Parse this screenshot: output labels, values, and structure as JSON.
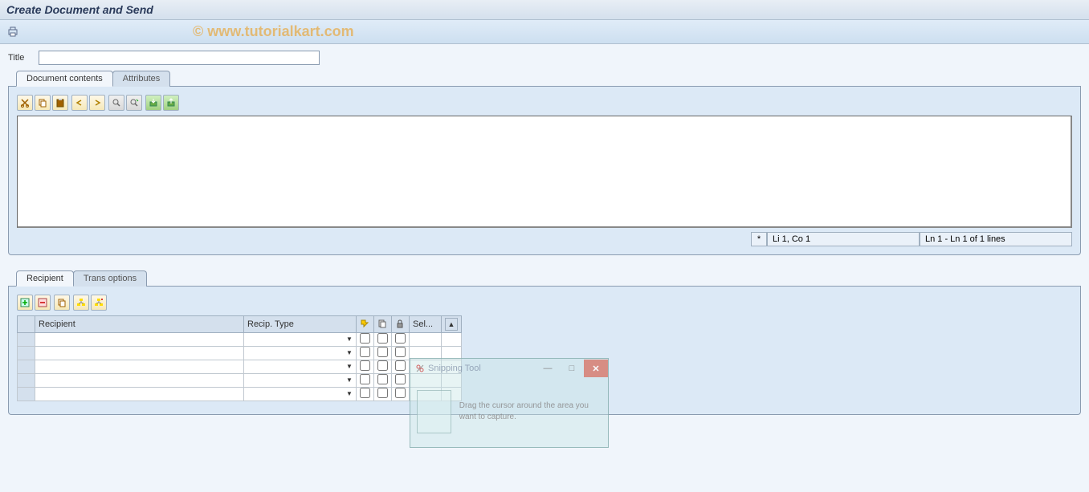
{
  "titlebar": {
    "text": "Create Document and Send"
  },
  "watermark": "© www.tutorialkart.com",
  "form": {
    "title_label": "Title",
    "title_value": ""
  },
  "upper_tabs": [
    {
      "label": "Document contents",
      "active": true
    },
    {
      "label": "Attributes",
      "active": false
    }
  ],
  "editor": {
    "content": "",
    "status_star": "*",
    "status_pos": "Li 1, Co 1",
    "status_lines": "Ln 1 - Ln 1 of 1 lines"
  },
  "lower_tabs": [
    {
      "label": "Recipient",
      "active": true
    },
    {
      "label": "Trans options",
      "active": false
    }
  ],
  "recip_table": {
    "headers": {
      "recipient": "Recipient",
      "recip_type": "Recip. Type",
      "sel": "Sel..."
    },
    "rows": [
      {
        "recipient": "",
        "type": "",
        "c1": false,
        "c2": false,
        "c3": false
      },
      {
        "recipient": "",
        "type": "",
        "c1": false,
        "c2": false,
        "c3": false
      },
      {
        "recipient": "",
        "type": "",
        "c1": false,
        "c2": false,
        "c3": false
      },
      {
        "recipient": "",
        "type": "",
        "c1": false,
        "c2": false,
        "c3": false
      },
      {
        "recipient": "",
        "type": "",
        "c1": false,
        "c2": false,
        "c3": false
      }
    ]
  },
  "snipping": {
    "title": "Snipping Tool",
    "hint": "Drag the cursor around the area you want to capture."
  }
}
